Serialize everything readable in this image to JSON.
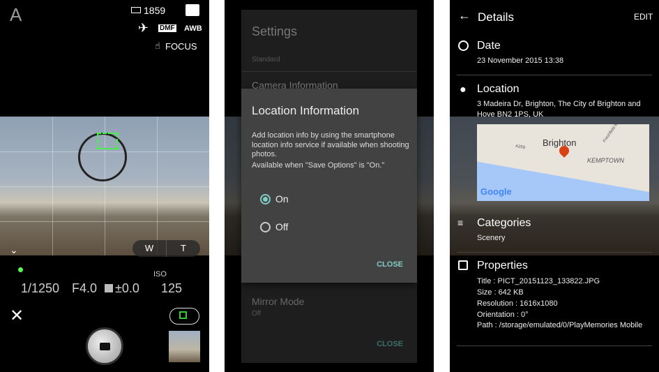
{
  "camera": {
    "mode": "A",
    "shots_remaining": "1859",
    "dmf": "DMF",
    "awb": "AWB",
    "focus": "FOCUS",
    "shutter": "1/1250",
    "aperture": "F4.0",
    "exposure": "±0.0",
    "iso_label": "ISO",
    "iso": "125",
    "zoom_w": "W",
    "zoom_t": "T"
  },
  "settings": {
    "title": "Settings",
    "item1_value": "Standard",
    "item2": "Camera Information",
    "item3": "Mirror Mode",
    "item3_value": "Off",
    "close": "CLOSE"
  },
  "location_dialog": {
    "title": "Location Information",
    "body": "Add location info by using the smartphone location info service if available when shooting photos.",
    "note": "Available when \"Save Options\" is \"On.\"",
    "options": [
      {
        "label": "On",
        "selected": true
      },
      {
        "label": "Off",
        "selected": false
      }
    ],
    "close": "CLOSE",
    "accent": "#80cbc4"
  },
  "details": {
    "title": "Details",
    "edit": "EDIT",
    "date": {
      "title": "Date",
      "value": "23 November 2015 13:38"
    },
    "location": {
      "title": "Location",
      "value": "3 Madeira Dr, Brighton, The City of Brighton and Hove BN2 1PS, UK",
      "map": {
        "city": "Brighton",
        "district": "KEMPTOWN",
        "road": "A259",
        "street": "Freshfield Rd",
        "logo": "Google"
      }
    },
    "categories": {
      "title": "Categories",
      "value": "Scenery"
    },
    "properties": {
      "title": "Properties",
      "lines": [
        "Title : PICT_20151123_133822.JPG",
        "Size : 642 KB",
        "Resolution : 1616x1080",
        "Orientation : 0°",
        "Path : /storage/emulated/0/PlayMemories Mobile"
      ]
    }
  }
}
